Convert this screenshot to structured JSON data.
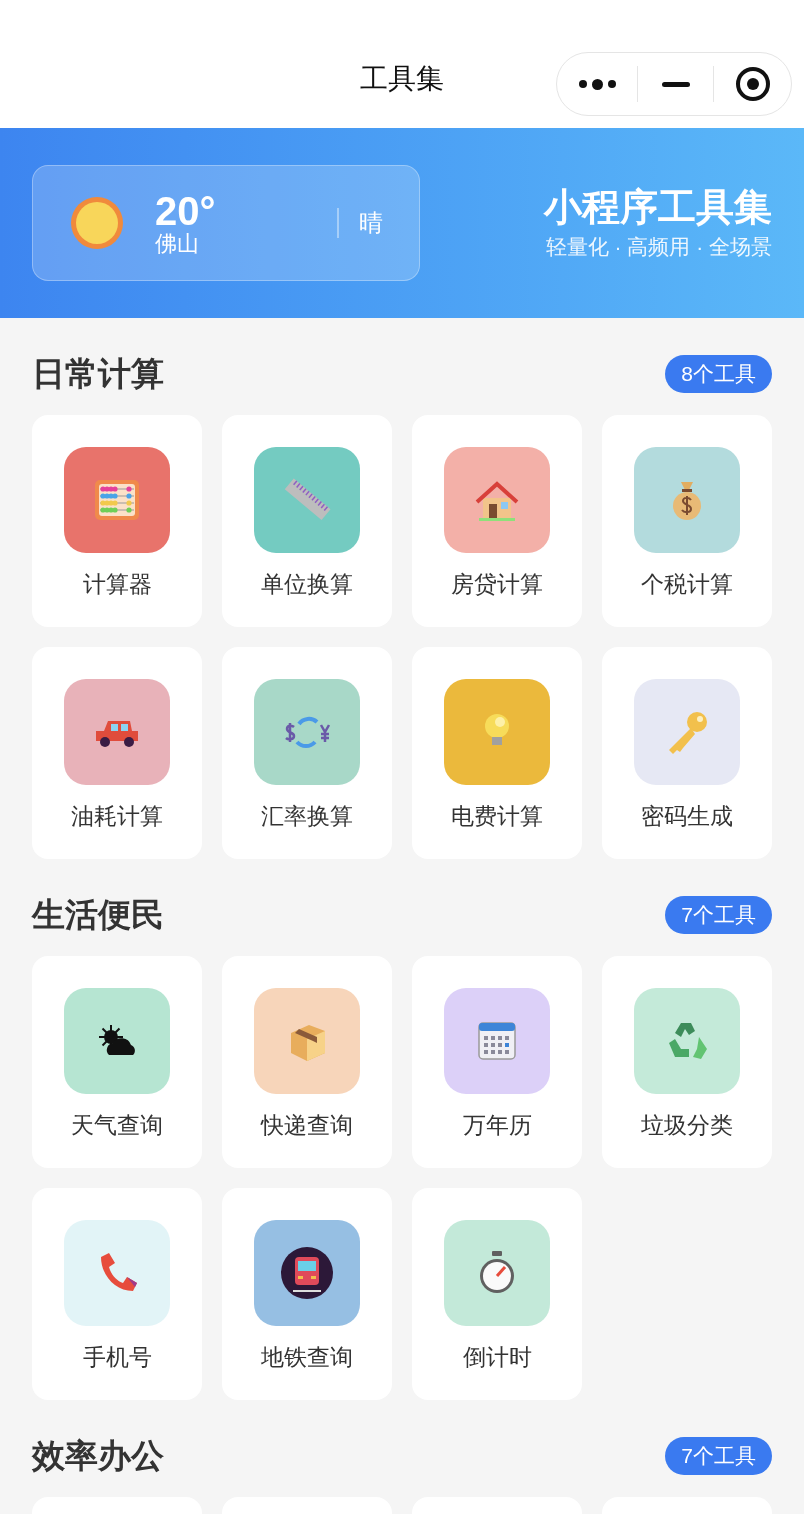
{
  "nav": {
    "title": "工具集"
  },
  "weather": {
    "temperature": "20°",
    "city": "佛山",
    "condition": "晴"
  },
  "banner": {
    "title": "小程序工具集",
    "subtitle": "轻量化 · 高频用 · 全场景"
  },
  "sections": [
    {
      "title": "日常计算",
      "count": "8个工具",
      "tools": [
        {
          "label": "计算器",
          "color": "#e8736b"
        },
        {
          "label": "单位换算",
          "color": "#74cbc1"
        },
        {
          "label": "房贷计算",
          "color": "#f3b0a8"
        },
        {
          "label": "个税计算",
          "color": "#b3dbdd"
        },
        {
          "label": "油耗计算",
          "color": "#e8b2b9"
        },
        {
          "label": "汇率换算",
          "color": "#a8d8c8"
        },
        {
          "label": "电费计算",
          "color": "#ebb93c"
        },
        {
          "label": "密码生成",
          "color": "#e6e8f4"
        }
      ]
    },
    {
      "title": "生活便民",
      "count": "7个工具",
      "tools": [
        {
          "label": "天气查询",
          "color": "#b6e5d2"
        },
        {
          "label": "快递查询",
          "color": "#f7d5ba"
        },
        {
          "label": "万年历",
          "color": "#dcd0f8"
        },
        {
          "label": "垃圾分类",
          "color": "#c4ead9"
        },
        {
          "label": "手机号",
          "color": "#e2f4f7"
        },
        {
          "label": "地铁查询",
          "color": "#96bfe3"
        },
        {
          "label": "倒计时",
          "color": "#c3e9d9"
        }
      ]
    },
    {
      "title": "效率办公",
      "count": "7个工具"
    }
  ]
}
